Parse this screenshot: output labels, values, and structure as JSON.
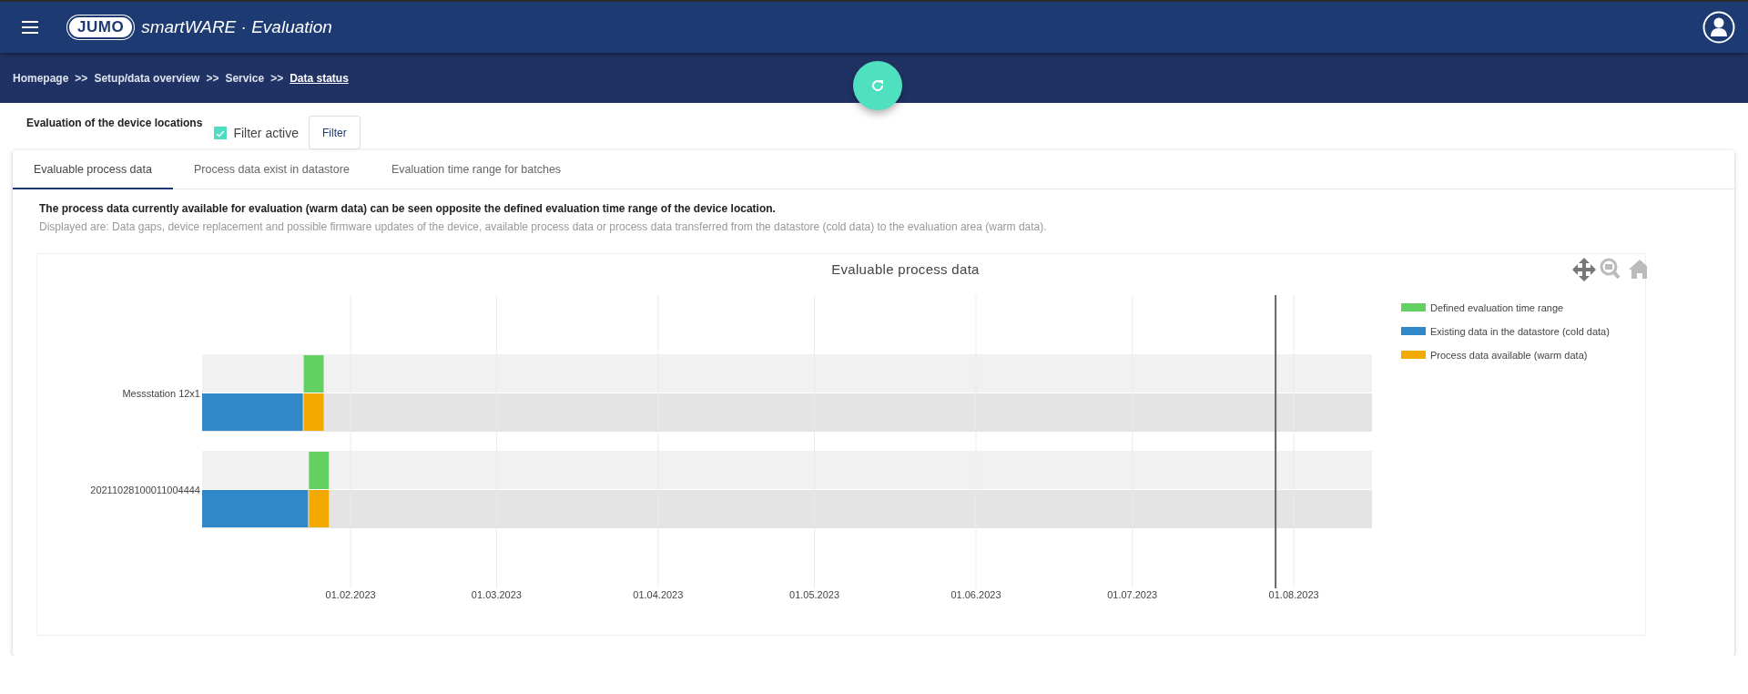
{
  "header": {
    "logo": "JUMO",
    "app_title": "smartWARE · Evaluation"
  },
  "breadcrumb": [
    {
      "label": "Homepage",
      "current": false
    },
    {
      "label": "Setup/data overview",
      "current": false
    },
    {
      "label": "Service",
      "current": false
    },
    {
      "label": "Data status",
      "current": true
    }
  ],
  "breadcrumb_separator": ">>",
  "filter_bar": {
    "title": "Evaluation of the device locations",
    "filter_active": {
      "label": "Filter active",
      "checked": true
    },
    "filter_button": "Filter"
  },
  "tabs": [
    {
      "label": "Evaluable process data",
      "selected": true
    },
    {
      "label": "Process data exist in datastore",
      "selected": false
    },
    {
      "label": "Evaluation time range for batches",
      "selected": false
    }
  ],
  "description": {
    "heading": "The process data currently available for evaluation (warm data) can be seen opposite the defined evaluation time range of the device location.",
    "text": "Displayed are: Data gaps, device replacement and possible firmware updates of the device, available process data or process data transferred from the datastore (cold data) to the evaluation area (warm data)."
  },
  "chart": {
    "title": "Evaluable process data",
    "rows": [
      {
        "label": "Messstation 12x1"
      },
      {
        "label": "20211028100011004444"
      }
    ],
    "legend": [
      {
        "label": "Defined evaluation time range",
        "color": "#62d162"
      },
      {
        "label": "Existing data in the datastore (cold data)",
        "color": "#3088c8"
      },
      {
        "label": "Process data available (warm data)",
        "color": "#f2a900"
      }
    ],
    "x_axis_labels": [
      "01.02.2023",
      "01.03.2023",
      "01.04.2023",
      "01.05.2023",
      "01.06.2023",
      "01.07.2023",
      "01.08.2023"
    ]
  }
}
